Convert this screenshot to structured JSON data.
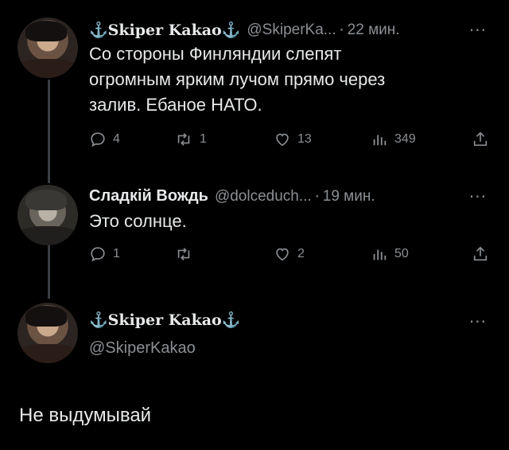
{
  "tweets": [
    {
      "name": "⚓Skiper Kakao⚓",
      "handle": "@SkiperKa...",
      "time": "22 мин.",
      "more": "···",
      "lines": [
        "Со стороны Финляндии слепят",
        "огромным ярким лучом прямо через",
        "залив. Ебаное НАТО."
      ],
      "replies": "4",
      "retweets": "1",
      "likes": "13",
      "views": "349"
    },
    {
      "name": "Сладкій Вождь",
      "handle": "@dolceduch...",
      "time": "19 мин.",
      "more": "···",
      "lines": [
        "Это солнце."
      ],
      "replies": "1",
      "retweets": "",
      "likes": "2",
      "views": "50"
    }
  ],
  "main_tweet": {
    "name": "⚓Skiper Kakao⚓",
    "handle": "@SkiperKakao",
    "more": "···",
    "text": "Не выдумывай"
  },
  "separator": "·"
}
